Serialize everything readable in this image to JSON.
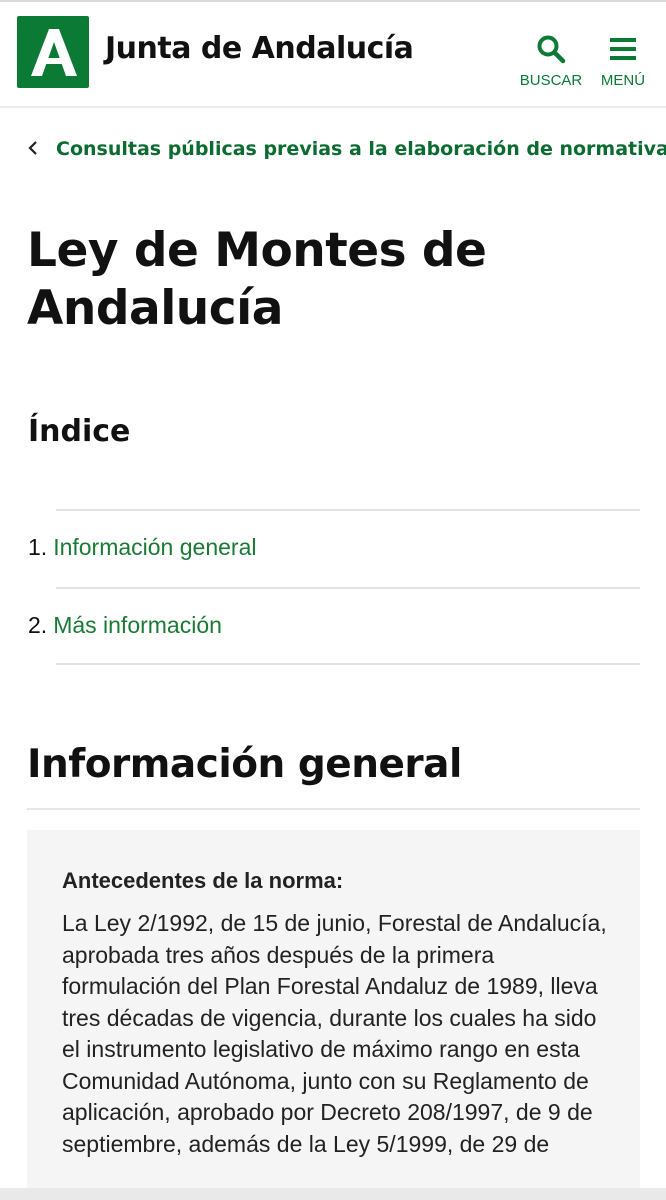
{
  "header": {
    "brand": "Junta de Andalucía",
    "search_label": "BUSCAR",
    "menu_label": "MENÚ",
    "brand_color": "#0b7a35",
    "logo_icon": "andalucia-a-logo",
    "search_icon": "search-icon",
    "menu_icon": "hamburger-icon"
  },
  "breadcrumb": {
    "back_icon": "chevron-left-icon",
    "label": "Consultas públicas previas a la elaboración de normativa"
  },
  "page": {
    "title": "Ley de Montes de Andalucía",
    "index_title": "Índice",
    "index_items": [
      {
        "number": "1.",
        "label": "Información general"
      },
      {
        "number": "2.",
        "label": "Más información"
      }
    ],
    "section_title": "Información general",
    "card": {
      "title": "Antecedentes de la norma:",
      "text": "La Ley 2/1992, de 15 de junio, Forestal de Andalucía, aprobada tres años después de la primera formulación del Plan Forestal Andaluz de 1989, lleva tres décadas de vigencia, durante los cuales ha sido el instrumento legislativo de máximo rango en esta Comunidad Autónoma, junto con su Reglamento de aplicación, aprobado por Decreto 208/1997, de 9 de septiembre, además de la Ley 5/1999, de 29 de"
    }
  }
}
